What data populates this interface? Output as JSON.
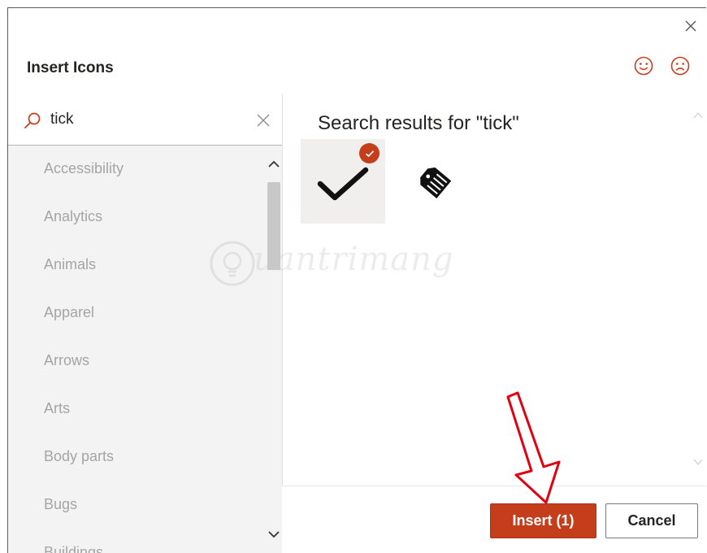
{
  "dialog": {
    "title": "Insert Icons",
    "close_icon": "close-icon",
    "feedback": {
      "happy_icon": "smile-icon",
      "sad_icon": "frown-icon"
    }
  },
  "search": {
    "value": "tick",
    "icon": "search-icon",
    "clear_icon": "clear-icon"
  },
  "categories": [
    "Accessibility",
    "Analytics",
    "Animals",
    "Apparel",
    "Arrows",
    "Arts",
    "Body parts",
    "Bugs",
    "Buildings"
  ],
  "results": {
    "heading": "Search results for \"tick\"",
    "items": [
      {
        "icon": "checkmark-icon",
        "selected": true
      },
      {
        "icon": "price-tag-icon",
        "selected": false
      }
    ]
  },
  "footer": {
    "insert_label": "Insert (1)",
    "cancel_label": "Cancel"
  },
  "watermark": {
    "text": "uantrimang"
  },
  "colors": {
    "accent": "#c43e1c",
    "category_text": "#a5a5a5",
    "category_bg": "#f3f3f3",
    "annotation_arrow": "#e0000f"
  }
}
